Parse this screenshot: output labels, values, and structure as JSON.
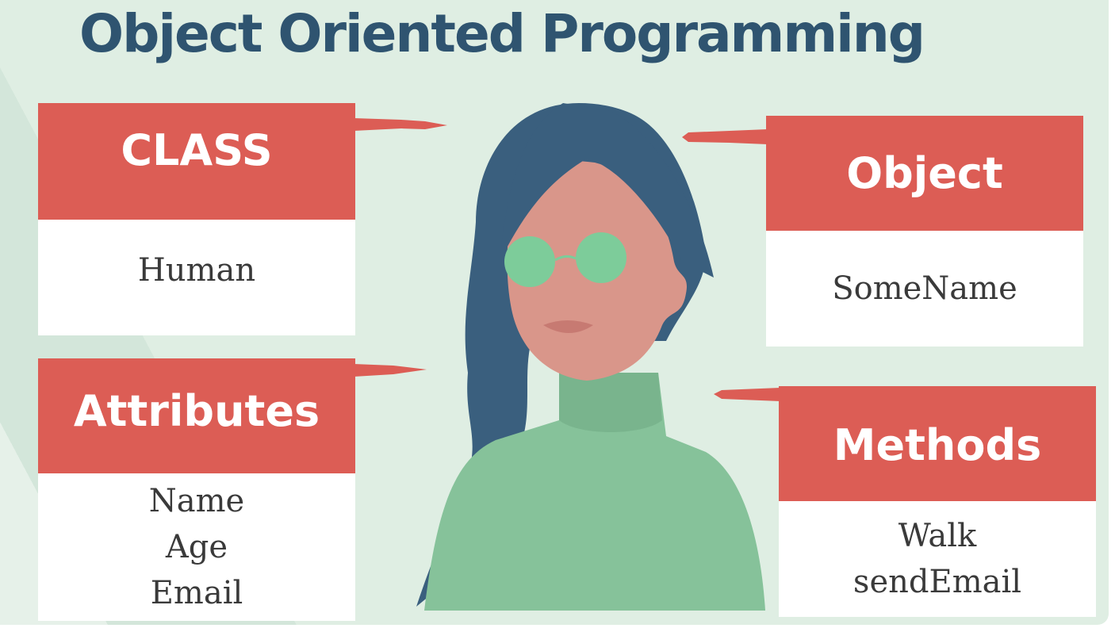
{
  "title": "Object Oriented Programming",
  "cards": {
    "class": {
      "heading": "CLASS",
      "items": [
        "Human"
      ]
    },
    "attributes": {
      "heading": "Attributes",
      "items": [
        "Name",
        "Age",
        "Email"
      ]
    },
    "object": {
      "heading": "Object",
      "items": [
        "SomeName"
      ]
    },
    "methods": {
      "heading": "Methods",
      "items": [
        "Walk",
        "sendEmail"
      ]
    }
  },
  "colors": {
    "accent": "#dc5d55",
    "title": "#2f5470",
    "background": "#dfeee3",
    "hair": "#3a5f7e",
    "skin": "#d9968a",
    "sweater": "#86c29a"
  }
}
